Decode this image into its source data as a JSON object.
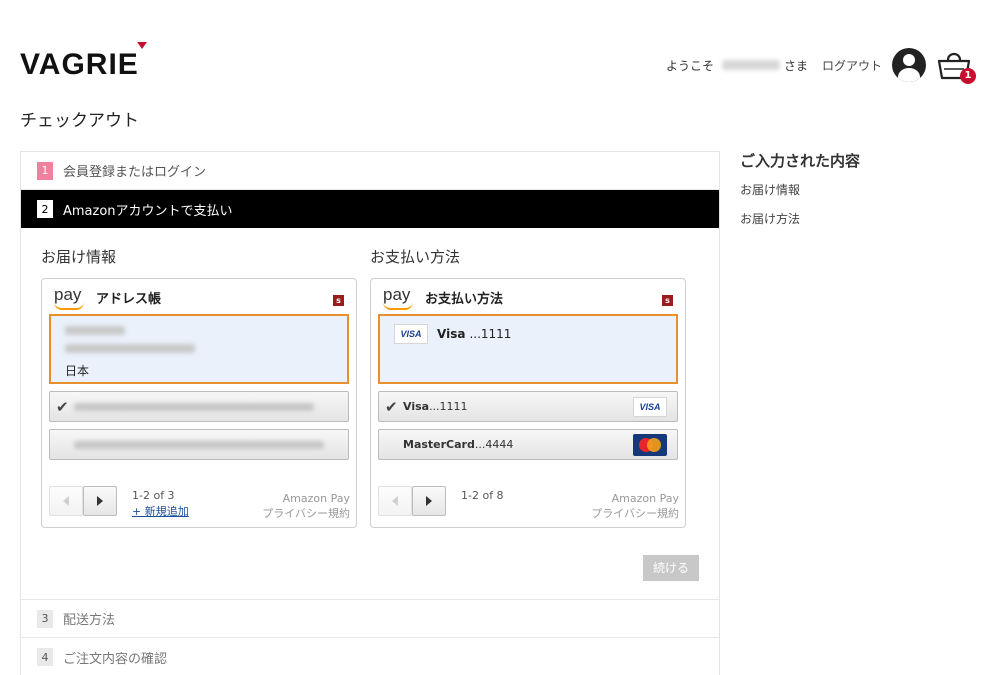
{
  "header": {
    "logo": "VAGRIE",
    "welcome": "ようこそ",
    "honorific": "さま",
    "logout_label": "ログアウト",
    "cart_count": "1"
  },
  "page_title": "チェックアウト",
  "steps": [
    {
      "num": "1",
      "label": "会員登録またはログイン",
      "state": "done"
    },
    {
      "num": "2",
      "label": "Amazonアカウントで支払い",
      "state": "active"
    },
    {
      "num": "3",
      "label": "配送方法",
      "state": "pending"
    },
    {
      "num": "4",
      "label": "ご注文内容の確認",
      "state": "pending"
    }
  ],
  "delivery": {
    "column_title": "お届け情報",
    "pay_text": "pay",
    "widget_title": "アドレス帳",
    "badge": "s",
    "selected_country": "日本",
    "pager_text": "1-2 of 3",
    "add_new": "+ 新規追加",
    "brand_line1": "Amazon Pay",
    "brand_line2": "プライバシー規約"
  },
  "payment": {
    "column_title": "お支払い方法",
    "pay_text": "pay",
    "widget_title": "お支払い方法",
    "badge": "s",
    "selected_card": "Visa",
    "selected_digits": "...1111",
    "options": [
      {
        "brand": "Visa",
        "digits": "...1111",
        "logo": "VISA"
      },
      {
        "brand": "MasterCard",
        "digits": "...4444",
        "logo": "MasterCard"
      }
    ],
    "visa_logo_text": "VISA",
    "pager_text": "1-2 of 8",
    "brand_line1": "Amazon Pay",
    "brand_line2": "プライバシー規約"
  },
  "continue_label": "続ける",
  "summary": {
    "title": "ご入力された内容",
    "items": [
      "お届け情報",
      "お届け方法"
    ]
  }
}
